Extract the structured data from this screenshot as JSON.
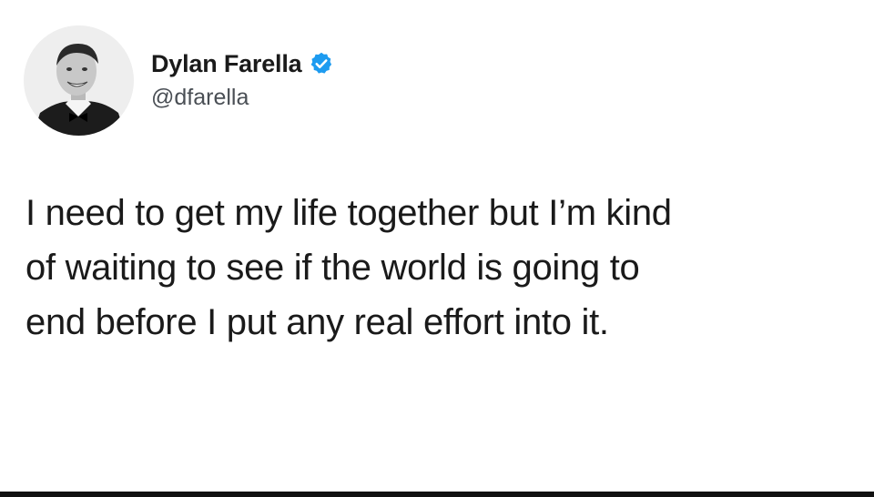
{
  "author": {
    "display_name": "Dylan Farella",
    "handle": "@dfarella",
    "avatar_icon": "profile-photo",
    "verified_icon": "verified-badge-icon",
    "verified_color": "#1d9bf0"
  },
  "tweet": {
    "lines": [
      "I need to get my life together but I’m kind",
      "of waiting to see if the world is going to",
      "end before I put any real effort into it."
    ]
  },
  "colors": {
    "background": "#ffffff",
    "text": "#1a1a1a",
    "handle": "#4a4f55",
    "bottom_bar": "#111111"
  }
}
